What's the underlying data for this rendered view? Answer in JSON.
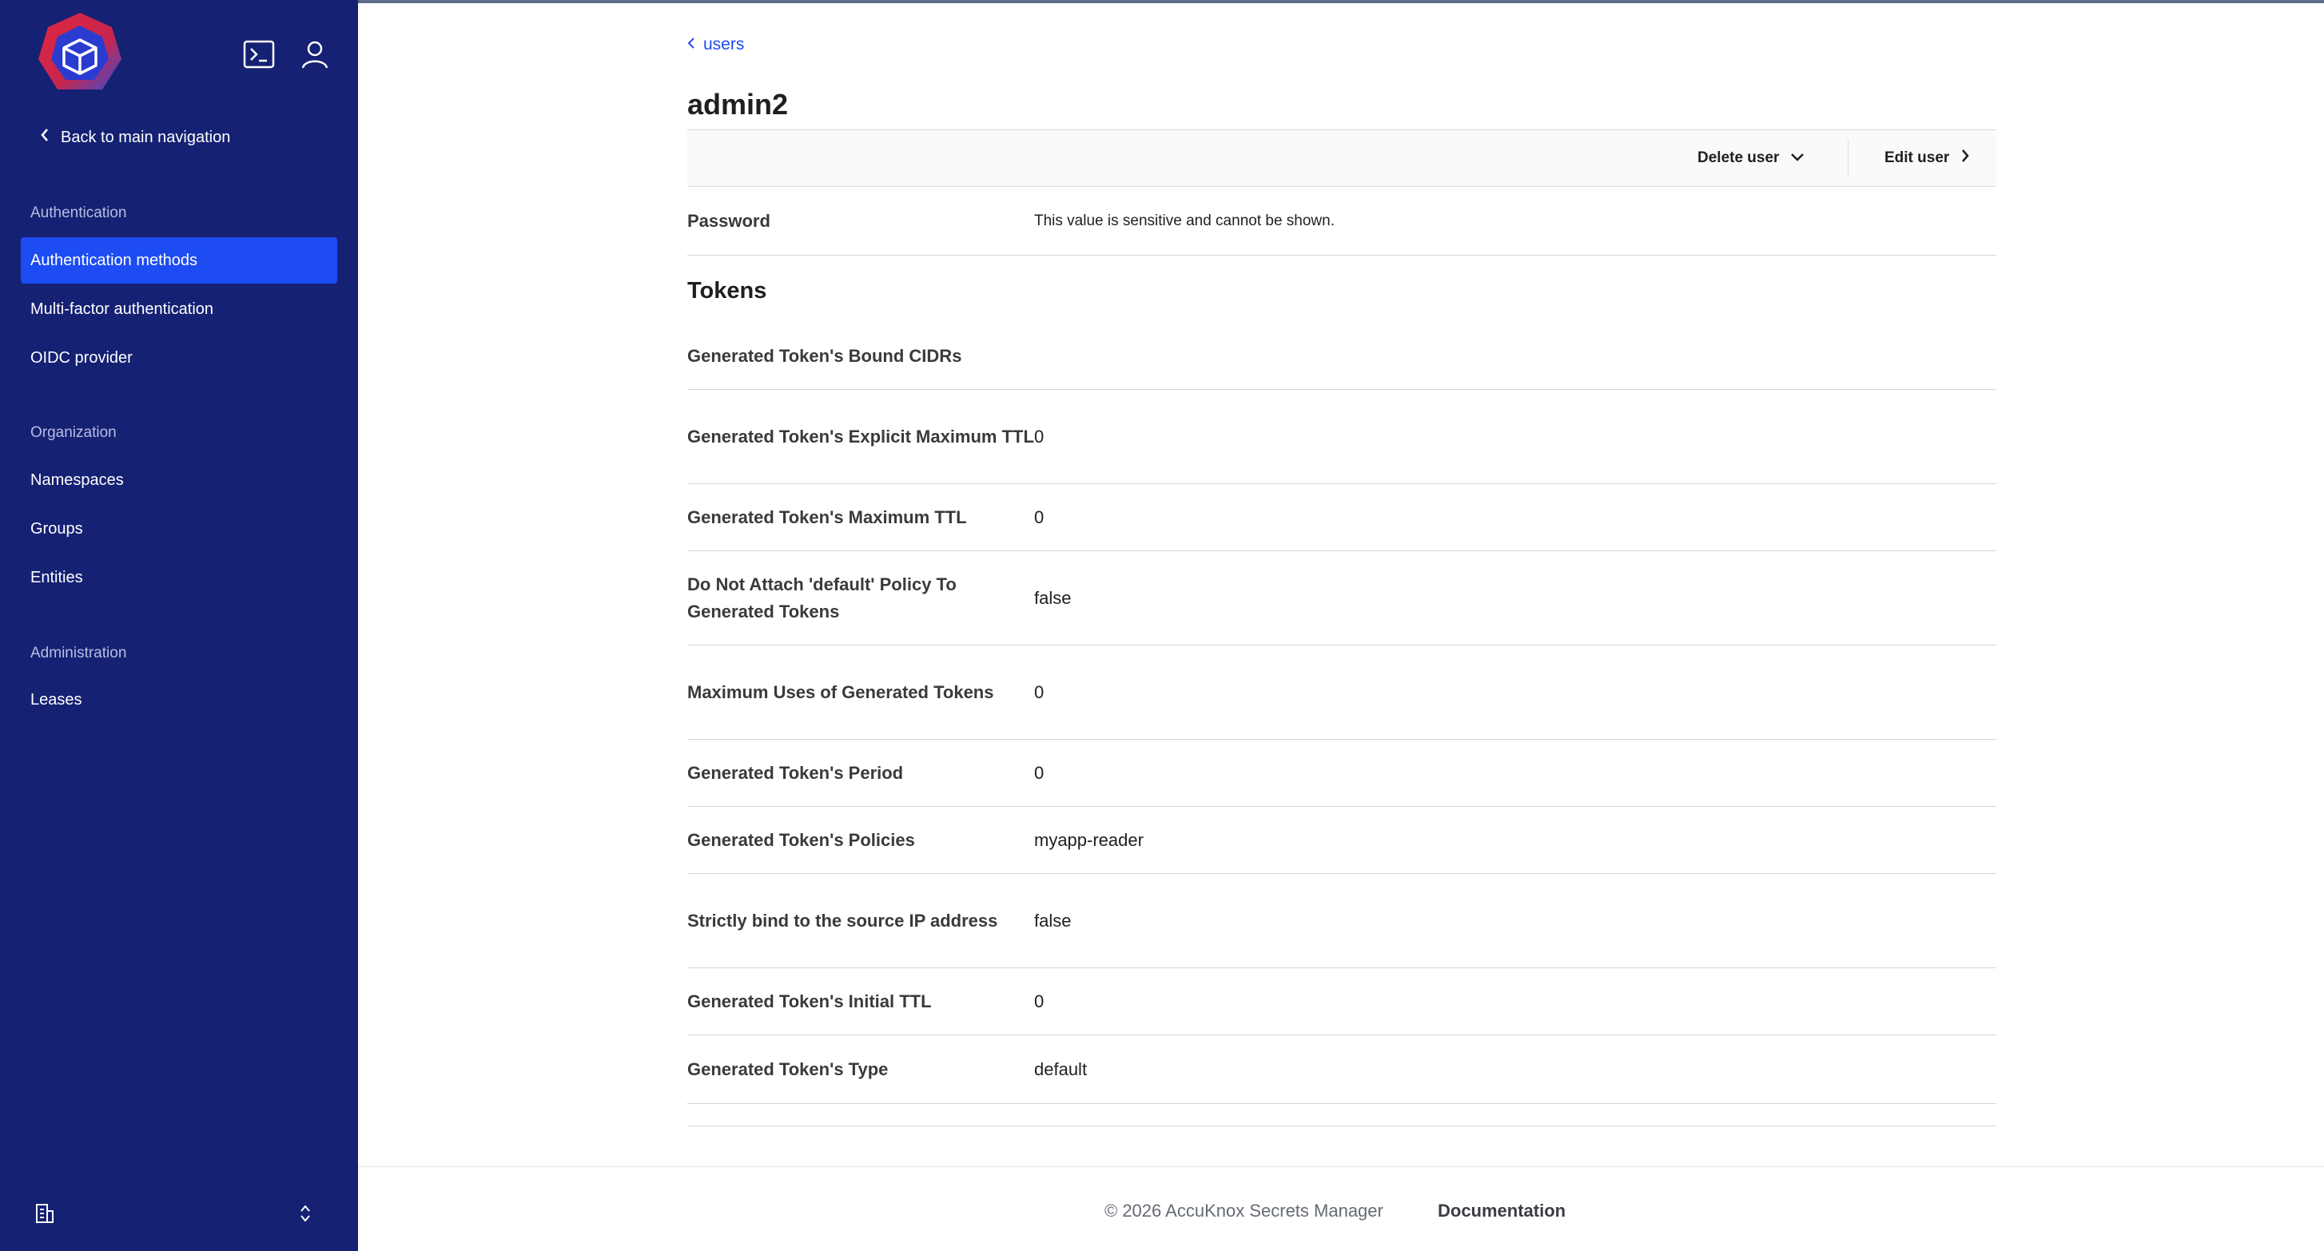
{
  "sidebar": {
    "back_label": "Back to main navigation",
    "sections": [
      {
        "title": "Authentication",
        "items": [
          "Authentication methods",
          "Multi-factor authentication",
          "OIDC provider"
        ]
      },
      {
        "title": "Organization",
        "items": [
          "Namespaces",
          "Groups",
          "Entities"
        ]
      },
      {
        "title": "Administration",
        "items": [
          "Leases"
        ]
      }
    ],
    "active_item": "Authentication methods"
  },
  "breadcrumb": {
    "label": "users"
  },
  "page": {
    "title": "admin2"
  },
  "toolbar": {
    "delete_label": "Delete user",
    "edit_label": "Edit user"
  },
  "password": {
    "label": "Password",
    "value": "This value is sensitive and cannot be shown."
  },
  "tokens": {
    "title": "Tokens",
    "rows": [
      {
        "label": "Generated Token's Bound CIDRs",
        "value": ""
      },
      {
        "label": "Generated Token's Explicit Maximum TTL",
        "value": "0"
      },
      {
        "label": "Generated Token's Maximum TTL",
        "value": "0"
      },
      {
        "label": "Do Not Attach 'default' Policy To Generated Tokens",
        "value": "false"
      },
      {
        "label": "Maximum Uses of Generated Tokens",
        "value": "0"
      },
      {
        "label": "Generated Token's Period",
        "value": "0"
      },
      {
        "label": "Generated Token's Policies",
        "value": "myapp-reader"
      },
      {
        "label": "Strictly bind to the source IP address",
        "value": "false"
      },
      {
        "label": "Generated Token's Initial TTL",
        "value": "0"
      },
      {
        "label": "Generated Token's Type",
        "value": "default"
      }
    ]
  },
  "footer": {
    "copyright": "© 2026 AccuKnox Secrets Manager",
    "docs_label": "Documentation"
  },
  "colors": {
    "sidebar_bg": "#152173",
    "accent": "#1d4cf2",
    "logo_red": "#e0273f"
  }
}
